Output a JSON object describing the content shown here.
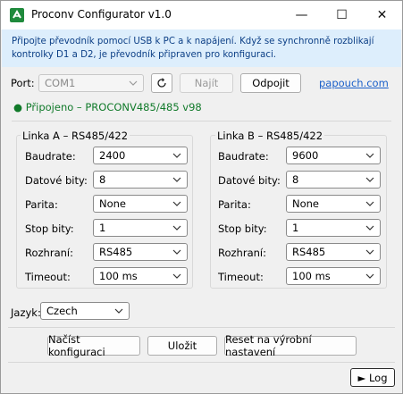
{
  "window": {
    "title": "Proconv Configurator  v1.0",
    "minimize_glyph": "—",
    "maximize_glyph": "☐",
    "close_glyph": "✕"
  },
  "info_banner": {
    "text": "Připojte převodník pomocí USB k PC a k napájení. Když se synchronně rozblikají kontrolky D1 a D2, je převodník připraven pro konfiguraci."
  },
  "port_row": {
    "label": "Port:",
    "port_value": "COM1",
    "refresh_icon": "refresh-icon",
    "find_label": "Najít",
    "disconnect_label": "Odpojit",
    "link_label": "papouch.com"
  },
  "status": {
    "text": "● Připojeno – PROCONV485/485 v98",
    "color": "#117a2a"
  },
  "line_a": {
    "title": "Linka A  –  RS485/422",
    "fields": [
      {
        "label": "Baudrate:",
        "value": "2400"
      },
      {
        "label": "Datové bity:",
        "value": "8"
      },
      {
        "label": "Parita:",
        "value": "None"
      },
      {
        "label": "Stop bity:",
        "value": "1"
      },
      {
        "label": "Rozhraní:",
        "value": "RS485"
      },
      {
        "label": "Timeout:",
        "value": "100 ms"
      }
    ]
  },
  "line_b": {
    "title": "Linka B  –  RS485/422",
    "fields": [
      {
        "label": "Baudrate:",
        "value": "9600"
      },
      {
        "label": "Datové bity:",
        "value": "8"
      },
      {
        "label": "Parita:",
        "value": "None"
      },
      {
        "label": "Stop bity:",
        "value": "1"
      },
      {
        "label": "Rozhraní:",
        "value": "RS485"
      },
      {
        "label": "Timeout:",
        "value": "100 ms"
      }
    ]
  },
  "language": {
    "label": "Jazyk:",
    "value": "Czech"
  },
  "actions": {
    "load_label": "Načíst konfiguraci",
    "save_label": "Uložit",
    "reset_label": "Reset na výrobní nastavení"
  },
  "log": {
    "label": "► Log"
  },
  "colors": {
    "accent_link": "#1a5fc9",
    "info_bg": "#ddeefc",
    "info_text": "#0c3f86",
    "status_green": "#117a2a"
  }
}
